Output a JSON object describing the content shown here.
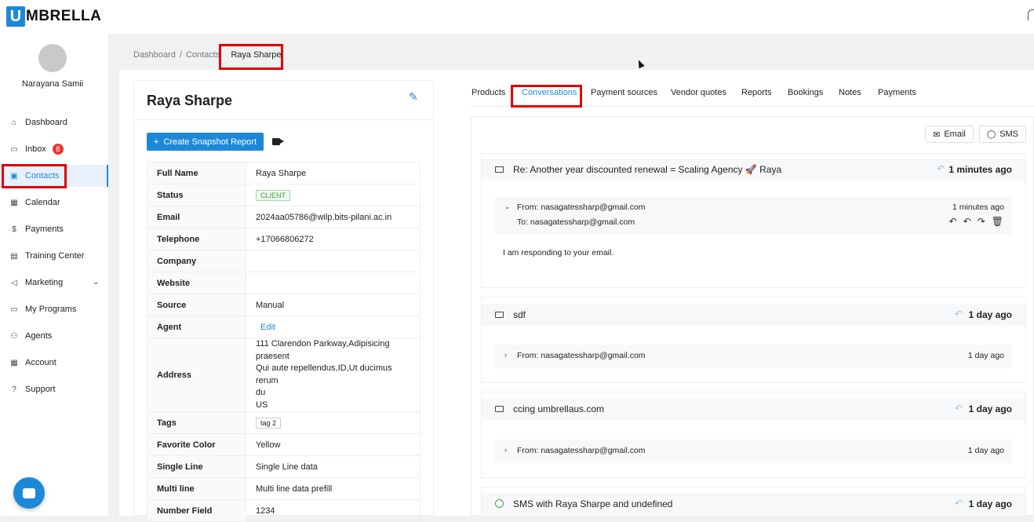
{
  "app": {
    "logo_letter": "U",
    "logo_text": "MBRELLA"
  },
  "user": {
    "name": "Narayana Samii"
  },
  "sidebar": {
    "items": [
      {
        "label": "Dashboard",
        "icon": "home-icon"
      },
      {
        "label": "Inbox",
        "icon": "inbox-icon",
        "badge": "8"
      },
      {
        "label": "Contacts",
        "icon": "contacts-icon"
      },
      {
        "label": "Calendar",
        "icon": "calendar-icon"
      },
      {
        "label": "Payments",
        "icon": "dollar-icon"
      },
      {
        "label": "Training Center",
        "icon": "book-icon"
      },
      {
        "label": "Marketing",
        "icon": "megaphone-icon"
      },
      {
        "label": "My Programs",
        "icon": "monitor-icon"
      },
      {
        "label": "Agents",
        "icon": "users-icon"
      },
      {
        "label": "Account",
        "icon": "account-icon"
      },
      {
        "label": "Support",
        "icon": "question-icon"
      }
    ]
  },
  "breadcrumb": {
    "dashboard": "Dashboard",
    "sep1": "/",
    "contacts": "Contacts",
    "current": "Raya Sharpe"
  },
  "contact": {
    "name": "Raya Sharpe",
    "snapshot_button": "Create Snapshot Report",
    "snapshot_plus": "+",
    "fields": {
      "full_name": {
        "label": "Full Name",
        "value": "Raya Sharpe"
      },
      "status": {
        "label": "Status",
        "value": "CLIENT"
      },
      "email": {
        "label": "Email",
        "value": "2024aa05786@wilp.bits-pilani.ac.in"
      },
      "telephone": {
        "label": "Telephone",
        "value": "+17066806272"
      },
      "company": {
        "label": "Company",
        "value": ""
      },
      "website": {
        "label": "Website",
        "value": ""
      },
      "source": {
        "label": "Source",
        "value": "Manual"
      },
      "agent": {
        "label": "Agent",
        "value": "Edit"
      },
      "address": {
        "label": "Address",
        "line1": "111 Clarendon Parkway,Adipisicing",
        "line2": "praesent",
        "line3": "Qui aute repellendus,ID,Ut ducimus rerum",
        "line4": "du",
        "line5": "US"
      },
      "tags": {
        "label": "Tags",
        "value": "tag 2"
      },
      "favorite_color": {
        "label": "Favorite Color",
        "value": "Yellow"
      },
      "single_line": {
        "label": "Single Line",
        "value": "Single Line data"
      },
      "multi_line": {
        "label": "Multi line",
        "value": "Multi line data prefill"
      },
      "number_field": {
        "label": "Number Field",
        "value": "1234"
      }
    }
  },
  "tabs": [
    "Products",
    "Conversations",
    "Payment sources",
    "Vendor quotes",
    "Reports",
    "Bookings",
    "Notes",
    "Payments"
  ],
  "active_tab": "Conversations",
  "actions": {
    "email": "Email",
    "sms": "SMS"
  },
  "threads": [
    {
      "subject": "Re: Another year discounted renewal = Scaling Agency 🚀 Raya",
      "time": "1 minutes ago",
      "message": {
        "from": "From: nasagatessharp@gmail.com",
        "to": "To: nasagatessharp@gmail.com",
        "time": "1 minutes ago",
        "body": "I am responding to your email."
      }
    },
    {
      "subject": "sdf",
      "time": "1 day ago",
      "message": {
        "from": "From: nasagatessharp@gmail.com",
        "time": "1 day ago"
      }
    },
    {
      "subject": "ccing umbrellaus.com",
      "time": "1 day ago",
      "message": {
        "from": "From: nasagatessharp@gmail.com",
        "time": "1 day ago"
      }
    },
    {
      "subject": "SMS with Raya Sharpe and undefined",
      "time": "1 day ago"
    }
  ],
  "colors": {
    "accent": "#1e88d8",
    "highlight": "#e00000",
    "badge": "#e53935",
    "client_tag": "#43a047"
  }
}
